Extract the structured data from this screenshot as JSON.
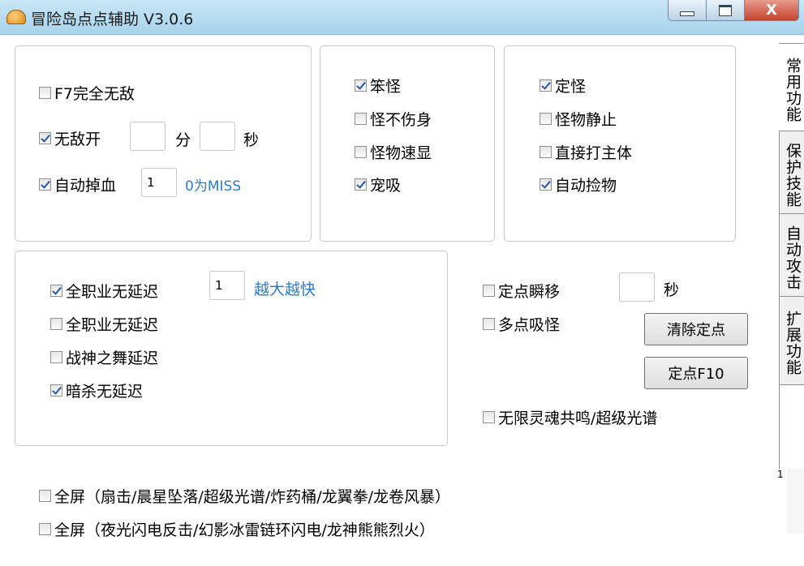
{
  "window": {
    "title": "冒险岛点点辅助 V3.0.6",
    "close_glyph": "X"
  },
  "tabs": [
    {
      "label": "常用功能",
      "active": true
    },
    {
      "label": "保护技能",
      "active": false
    },
    {
      "label": "自动攻击",
      "active": false
    },
    {
      "label": "扩展功能",
      "active": false
    }
  ],
  "panel1": {
    "f7": {
      "label": "F7完全无敌",
      "checked": false
    },
    "wudi": {
      "label": "无敌开",
      "checked": true,
      "min_value": "",
      "min_unit": "分",
      "sec_value": "",
      "sec_unit": "秒"
    },
    "diaoxue": {
      "label": "自动掉血",
      "checked": true,
      "value": "1",
      "hint": "0为MISS"
    }
  },
  "panel2": {
    "bengguai": {
      "label": "笨怪",
      "checked": true
    },
    "buzhangshen": {
      "label": "怪不伤身",
      "checked": false
    },
    "suxian": {
      "label": "怪物速显",
      "checked": false
    },
    "chongxi": {
      "label": "宠吸",
      "checked": true
    }
  },
  "panel3": {
    "dingguai": {
      "label": "定怪",
      "checked": true
    },
    "jingzhi": {
      "label": "怪物静止",
      "checked": false
    },
    "zhuti": {
      "label": "直接打主体",
      "checked": false
    },
    "jianwu": {
      "label": "自动捡物",
      "checked": true
    }
  },
  "panel4": {
    "quanzhiye1": {
      "label": "全职业无延迟",
      "checked": true,
      "value": "1",
      "hint": "越大越快"
    },
    "quanzhiye2": {
      "label": "全职业无延迟",
      "checked": false
    },
    "zhanshen": {
      "label": "战神之舞延迟",
      "checked": false
    },
    "ansha": {
      "label": "暗杀无延迟",
      "checked": true
    }
  },
  "right_group": {
    "shunyi": {
      "label": "定点瞬移",
      "checked": false,
      "value": "",
      "unit": "秒"
    },
    "duodian": {
      "label": "多点吸怪",
      "checked": false
    },
    "clear_button": "清除定点",
    "set_button": "定点F10",
    "wuxian": {
      "label": "无限灵魂共鸣/超级光谱",
      "checked": false
    }
  },
  "bottom": {
    "full1": {
      "label": "全屏（扇击/晨星坠落/超级光谱/炸药桶/龙翼拳/龙卷风暴）",
      "checked": false
    },
    "full2": {
      "label": "全屏（夜光闪电反击/幻影冰雷链环闪电/龙神熊熊烈火）",
      "checked": false
    }
  },
  "scroll_stub": "1"
}
